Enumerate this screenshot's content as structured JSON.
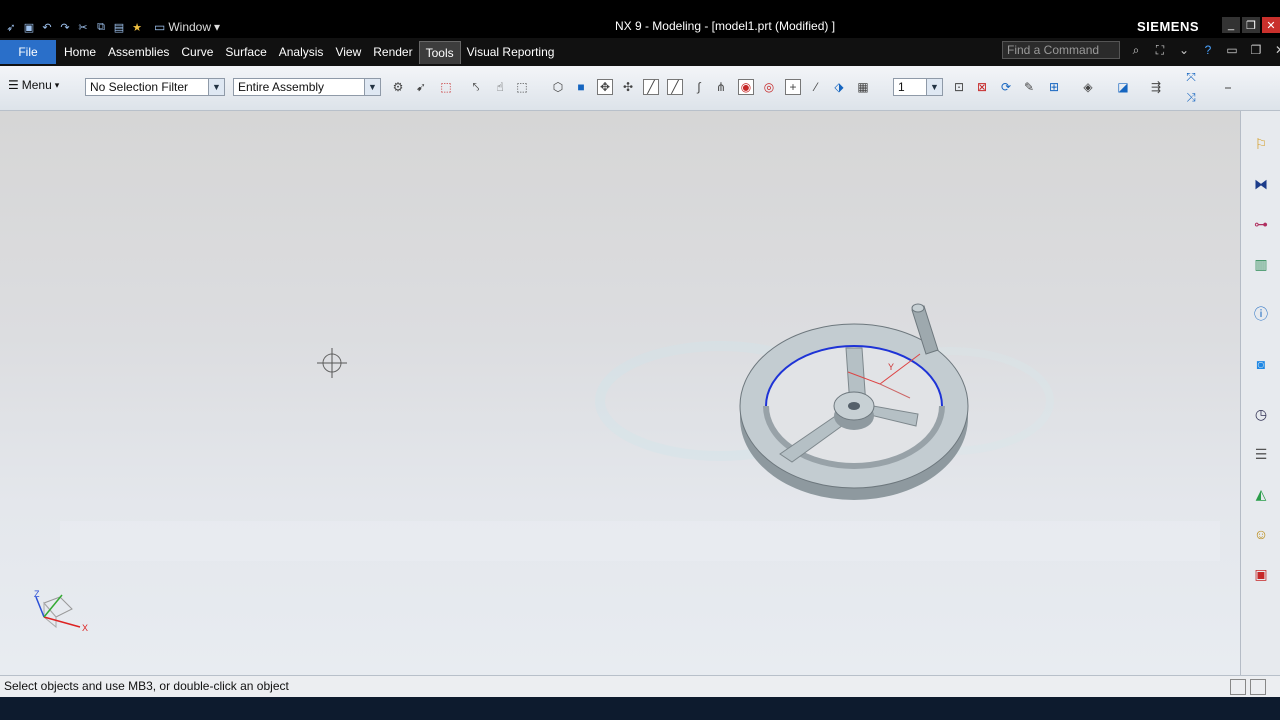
{
  "app": {
    "title": "NX 9 - Modeling - [model1.prt (Modified) ]",
    "brand": "SIEMENS",
    "window_menu": "Window"
  },
  "ribbon": {
    "file_tab": "File",
    "tabs": [
      "Home",
      "Assemblies",
      "Curve",
      "Surface",
      "Analysis",
      "View",
      "Render",
      "Tools",
      "Visual Reporting"
    ],
    "active_tab": "Tools",
    "command_finder_placeholder": "Find a Command"
  },
  "toolbar": {
    "menu_label": "Menu",
    "selection_filter": "No Selection Filter",
    "scope": "Entire Assembly",
    "layer": "1"
  },
  "status": {
    "message": "Select objects and use MB3, or double-click an object"
  },
  "triad": {
    "x_label": "X",
    "y_label": "Y",
    "z_label": "Z"
  },
  "colors": {
    "ribbon_bg": "#111111",
    "file_tab": "#2a6fc9",
    "model_body": "#b9c4c9",
    "edge_highlight": "#1e33d6"
  }
}
